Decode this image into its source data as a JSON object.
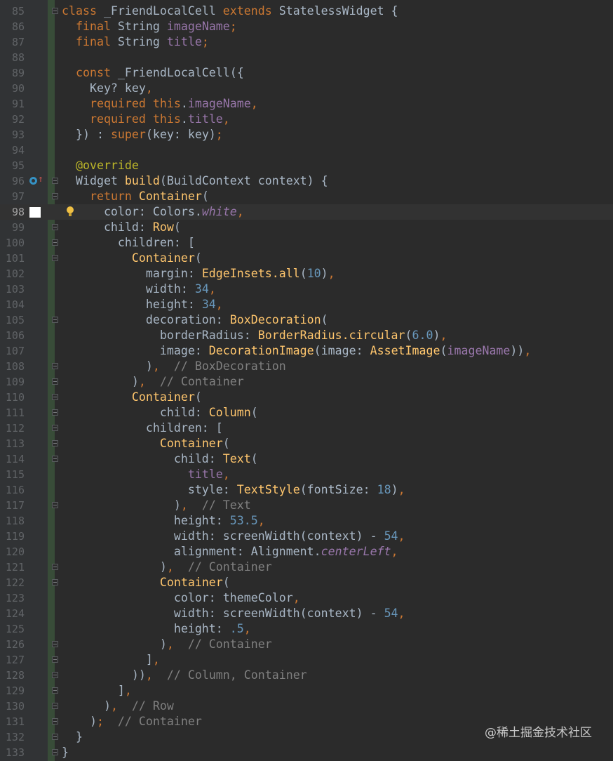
{
  "editor": {
    "current_line": 98,
    "lines": [
      {
        "n": "85",
        "t": [
          [
            "k",
            "class"
          ],
          [
            "p",
            " _FriendLocalCell "
          ],
          [
            "k",
            "extends"
          ],
          [
            "p",
            " StatelessWidget {"
          ]
        ]
      },
      {
        "n": "86",
        "t": [
          [
            "p",
            "  "
          ],
          [
            "k",
            "final"
          ],
          [
            "p",
            " String "
          ],
          [
            "f",
            "imageName"
          ],
          [
            "k",
            ";"
          ]
        ]
      },
      {
        "n": "87",
        "t": [
          [
            "p",
            "  "
          ],
          [
            "k",
            "final"
          ],
          [
            "p",
            " String "
          ],
          [
            "f",
            "title"
          ],
          [
            "k",
            ";"
          ]
        ]
      },
      {
        "n": "88",
        "t": []
      },
      {
        "n": "89",
        "t": [
          [
            "p",
            "  "
          ],
          [
            "k",
            "const"
          ],
          [
            "p",
            " _FriendLocalCell({"
          ]
        ]
      },
      {
        "n": "90",
        "t": [
          [
            "p",
            "    Key? key"
          ],
          [
            "k",
            ","
          ]
        ]
      },
      {
        "n": "91",
        "t": [
          [
            "p",
            "    "
          ],
          [
            "k",
            "required this"
          ],
          [
            "p",
            "."
          ],
          [
            "f",
            "imageName"
          ],
          [
            "k",
            ","
          ]
        ]
      },
      {
        "n": "92",
        "t": [
          [
            "p",
            "    "
          ],
          [
            "k",
            "required this"
          ],
          [
            "p",
            "."
          ],
          [
            "f",
            "title"
          ],
          [
            "k",
            ","
          ]
        ]
      },
      {
        "n": "93",
        "t": [
          [
            "p",
            "  }) : "
          ],
          [
            "k",
            "super"
          ],
          [
            "p",
            "(key: key)"
          ],
          [
            "k",
            ";"
          ]
        ]
      },
      {
        "n": "94",
        "t": []
      },
      {
        "n": "95",
        "t": [
          [
            "p",
            "  "
          ],
          [
            "a",
            "@override"
          ]
        ]
      },
      {
        "n": "96",
        "t": [
          [
            "p",
            "  Widget "
          ],
          [
            "y",
            "build"
          ],
          [
            "p",
            "(BuildContext context) {"
          ]
        ]
      },
      {
        "n": "97",
        "t": [
          [
            "p",
            "    "
          ],
          [
            "k",
            "return "
          ],
          [
            "y",
            "Container"
          ],
          [
            "p",
            "("
          ]
        ]
      },
      {
        "n": "98",
        "t": [
          [
            "p",
            "      color: Colors."
          ],
          [
            "i",
            "white"
          ],
          [
            "k",
            ","
          ]
        ]
      },
      {
        "n": "99",
        "t": [
          [
            "p",
            "      child: "
          ],
          [
            "y",
            "Row"
          ],
          [
            "p",
            "("
          ]
        ]
      },
      {
        "n": "100",
        "t": [
          [
            "p",
            "        children: ["
          ]
        ]
      },
      {
        "n": "101",
        "t": [
          [
            "p",
            "          "
          ],
          [
            "y",
            "Container"
          ],
          [
            "p",
            "("
          ]
        ]
      },
      {
        "n": "102",
        "t": [
          [
            "p",
            "            margin: "
          ],
          [
            "y",
            "EdgeInsets.all"
          ],
          [
            "p",
            "("
          ],
          [
            "n",
            "10"
          ],
          [
            "p",
            ")"
          ],
          [
            "k",
            ","
          ]
        ]
      },
      {
        "n": "103",
        "t": [
          [
            "p",
            "            width: "
          ],
          [
            "n",
            "34"
          ],
          [
            "k",
            ","
          ]
        ]
      },
      {
        "n": "104",
        "t": [
          [
            "p",
            "            height: "
          ],
          [
            "n",
            "34"
          ],
          [
            "k",
            ","
          ]
        ]
      },
      {
        "n": "105",
        "t": [
          [
            "p",
            "            decoration: "
          ],
          [
            "y",
            "BoxDecoration"
          ],
          [
            "p",
            "("
          ]
        ]
      },
      {
        "n": "106",
        "t": [
          [
            "p",
            "              borderRadius: "
          ],
          [
            "y",
            "BorderRadius.circular"
          ],
          [
            "p",
            "("
          ],
          [
            "n",
            "6.0"
          ],
          [
            "p",
            ")"
          ],
          [
            "k",
            ","
          ]
        ]
      },
      {
        "n": "107",
        "t": [
          [
            "p",
            "              image: "
          ],
          [
            "y",
            "DecorationImage"
          ],
          [
            "p",
            "(image: "
          ],
          [
            "y",
            "AssetImage"
          ],
          [
            "p",
            "("
          ],
          [
            "f",
            "imageName"
          ],
          [
            "p",
            "))"
          ],
          [
            "k",
            ","
          ]
        ]
      },
      {
        "n": "108",
        "t": [
          [
            "p",
            "            )"
          ],
          [
            "k",
            ","
          ],
          [
            "c",
            "  // BoxDecoration"
          ]
        ]
      },
      {
        "n": "109",
        "t": [
          [
            "p",
            "          )"
          ],
          [
            "k",
            ","
          ],
          [
            "c",
            "  // Container"
          ]
        ]
      },
      {
        "n": "110",
        "t": [
          [
            "p",
            "          "
          ],
          [
            "y",
            "Container"
          ],
          [
            "p",
            "("
          ]
        ]
      },
      {
        "n": "111",
        "t": [
          [
            "p",
            "              child: "
          ],
          [
            "y",
            "Column"
          ],
          [
            "p",
            "("
          ]
        ]
      },
      {
        "n": "112",
        "t": [
          [
            "p",
            "            children: ["
          ]
        ]
      },
      {
        "n": "113",
        "t": [
          [
            "p",
            "              "
          ],
          [
            "y",
            "Container"
          ],
          [
            "p",
            "("
          ]
        ]
      },
      {
        "n": "114",
        "t": [
          [
            "p",
            "                child: "
          ],
          [
            "y",
            "Text"
          ],
          [
            "p",
            "("
          ]
        ]
      },
      {
        "n": "115",
        "t": [
          [
            "p",
            "                  "
          ],
          [
            "f",
            "title"
          ],
          [
            "k",
            ","
          ]
        ]
      },
      {
        "n": "116",
        "t": [
          [
            "p",
            "                  style: "
          ],
          [
            "y",
            "TextStyle"
          ],
          [
            "p",
            "(fontSize: "
          ],
          [
            "n",
            "18"
          ],
          [
            "p",
            ")"
          ],
          [
            "k",
            ","
          ]
        ]
      },
      {
        "n": "117",
        "t": [
          [
            "p",
            "                )"
          ],
          [
            "k",
            ","
          ],
          [
            "c",
            "  // Text"
          ]
        ]
      },
      {
        "n": "118",
        "t": [
          [
            "p",
            "                height: "
          ],
          [
            "n",
            "53.5"
          ],
          [
            "k",
            ","
          ]
        ]
      },
      {
        "n": "119",
        "t": [
          [
            "p",
            "                width: screenWidth(context) - "
          ],
          [
            "n",
            "54"
          ],
          [
            "k",
            ","
          ]
        ]
      },
      {
        "n": "120",
        "t": [
          [
            "p",
            "                alignment: Alignment."
          ],
          [
            "i",
            "centerLeft"
          ],
          [
            "k",
            ","
          ]
        ]
      },
      {
        "n": "121",
        "t": [
          [
            "p",
            "              )"
          ],
          [
            "k",
            ","
          ],
          [
            "c",
            "  // Container"
          ]
        ]
      },
      {
        "n": "122",
        "t": [
          [
            "p",
            "              "
          ],
          [
            "y",
            "Container"
          ],
          [
            "p",
            "("
          ]
        ]
      },
      {
        "n": "123",
        "t": [
          [
            "p",
            "                color: themeColor"
          ],
          [
            "k",
            ","
          ]
        ]
      },
      {
        "n": "124",
        "t": [
          [
            "p",
            "                width: screenWidth(context) - "
          ],
          [
            "n",
            "54"
          ],
          [
            "k",
            ","
          ]
        ]
      },
      {
        "n": "125",
        "t": [
          [
            "p",
            "                height: "
          ],
          [
            "n",
            ".5"
          ],
          [
            "k",
            ","
          ]
        ]
      },
      {
        "n": "126",
        "t": [
          [
            "p",
            "              )"
          ],
          [
            "k",
            ","
          ],
          [
            "c",
            "  // Container"
          ]
        ]
      },
      {
        "n": "127",
        "t": [
          [
            "p",
            "            ]"
          ],
          [
            "k",
            ","
          ]
        ]
      },
      {
        "n": "128",
        "t": [
          [
            "p",
            "          ))"
          ],
          [
            "k",
            ","
          ],
          [
            "c",
            "  // Column, Container"
          ]
        ]
      },
      {
        "n": "129",
        "t": [
          [
            "p",
            "        ]"
          ],
          [
            "k",
            ","
          ]
        ]
      },
      {
        "n": "130",
        "t": [
          [
            "p",
            "      )"
          ],
          [
            "k",
            ","
          ],
          [
            "c",
            "  // Row"
          ]
        ]
      },
      {
        "n": "131",
        "t": [
          [
            "p",
            "    )"
          ],
          [
            "k",
            ";"
          ],
          [
            "c",
            "  // Container"
          ]
        ]
      },
      {
        "n": "132",
        "t": [
          [
            "p",
            "  }"
          ]
        ]
      },
      {
        "n": "133",
        "t": [
          [
            "p",
            "}"
          ]
        ]
      }
    ]
  },
  "watermark": "@稀土掘金技术社区"
}
